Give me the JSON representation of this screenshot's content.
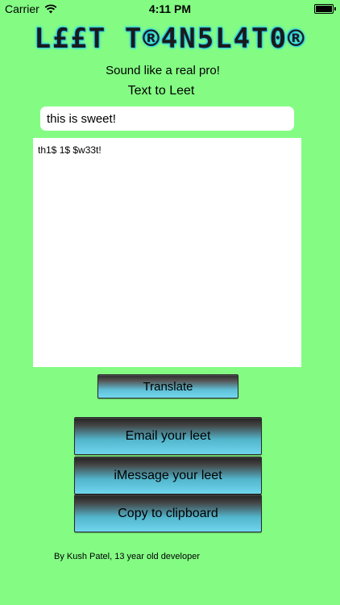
{
  "status_bar": {
    "carrier": "Carrier",
    "wifi_icon": "wifi-icon",
    "time": "4:11 PM",
    "battery_icon": "battery-icon"
  },
  "header": {
    "logo_text": "L££T T®4N5L4T0®",
    "tagline": "Sound like a real pro!",
    "mode": "Text to Leet"
  },
  "input": {
    "value": "this is sweet!"
  },
  "output": {
    "text": "th1$ 1$ $w33t!"
  },
  "buttons": {
    "translate": "Translate",
    "email": "Email your leet",
    "imessage": "iMessage your leet",
    "copy": "Copy to clipboard"
  },
  "footer": {
    "credit": "By Kush Patel, 13 year old developer"
  },
  "colors": {
    "background": "#84fc84",
    "button_accent": "#6fd6ee",
    "logo_glow": "#29c7e6"
  }
}
